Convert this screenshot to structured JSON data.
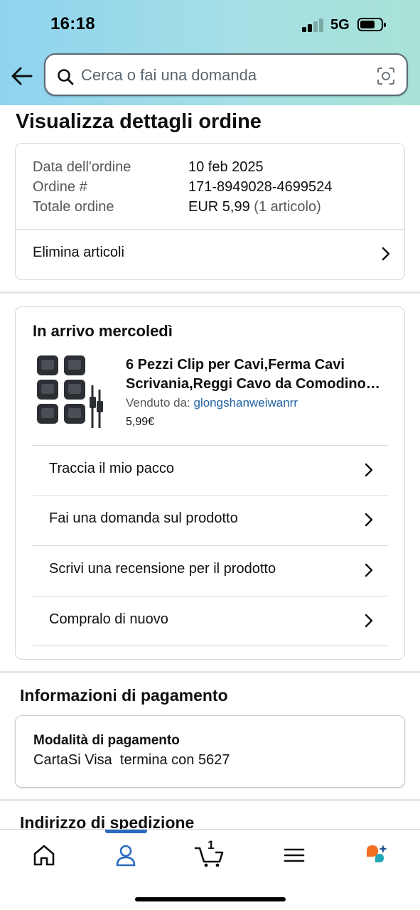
{
  "status_bar": {
    "time": "16:18",
    "network": "5G"
  },
  "search": {
    "placeholder": "Cerca o fai una domanda"
  },
  "page": {
    "title": "Visualizza dettagli ordine"
  },
  "order_summary": {
    "date_label": "Data dell'ordine",
    "date_value": "10 feb 2025",
    "number_label": "Ordine #",
    "number_value": "171-8949028-4699524",
    "total_label": "Totale ordine",
    "total_value": "EUR 5,99",
    "total_count": "(1 articolo)",
    "delete_items_label": "Elimina articoli"
  },
  "shipment": {
    "title": "In arrivo mercoledì",
    "product_name": "6 Pezzi Clip per Cavi,Ferma Cavi Scrivania,Reggi Cavo da Comodino…",
    "seller_label": "Venduto da:",
    "seller_name": "glongshanweiwanrr",
    "price": "5,99€",
    "actions": [
      {
        "label": "Traccia il mio pacco"
      },
      {
        "label": "Fai una domanda sul prodotto"
      },
      {
        "label": "Scrivi una recensione per il prodotto"
      },
      {
        "label": "Compralo di nuovo"
      }
    ]
  },
  "payment": {
    "section_title": "Informazioni di pagamento",
    "method_label": "Modalità di pagamento",
    "method_value": "CartaSi Visa  termina con 5627"
  },
  "shipping_address": {
    "section_title": "Indirizzo di spedizione"
  },
  "bottom_nav": {
    "items": [
      {
        "icon": "home-icon"
      },
      {
        "icon": "account-icon",
        "active": true
      },
      {
        "icon": "cart-icon",
        "count": "1"
      },
      {
        "icon": "menu-icon"
      },
      {
        "icon": "rufus-assistant-icon"
      }
    ]
  },
  "colors": {
    "accent": "#2a6bc0",
    "link": "#2162a1",
    "header_start": "#8fd3ef",
    "header_end": "#a8e2d6"
  }
}
